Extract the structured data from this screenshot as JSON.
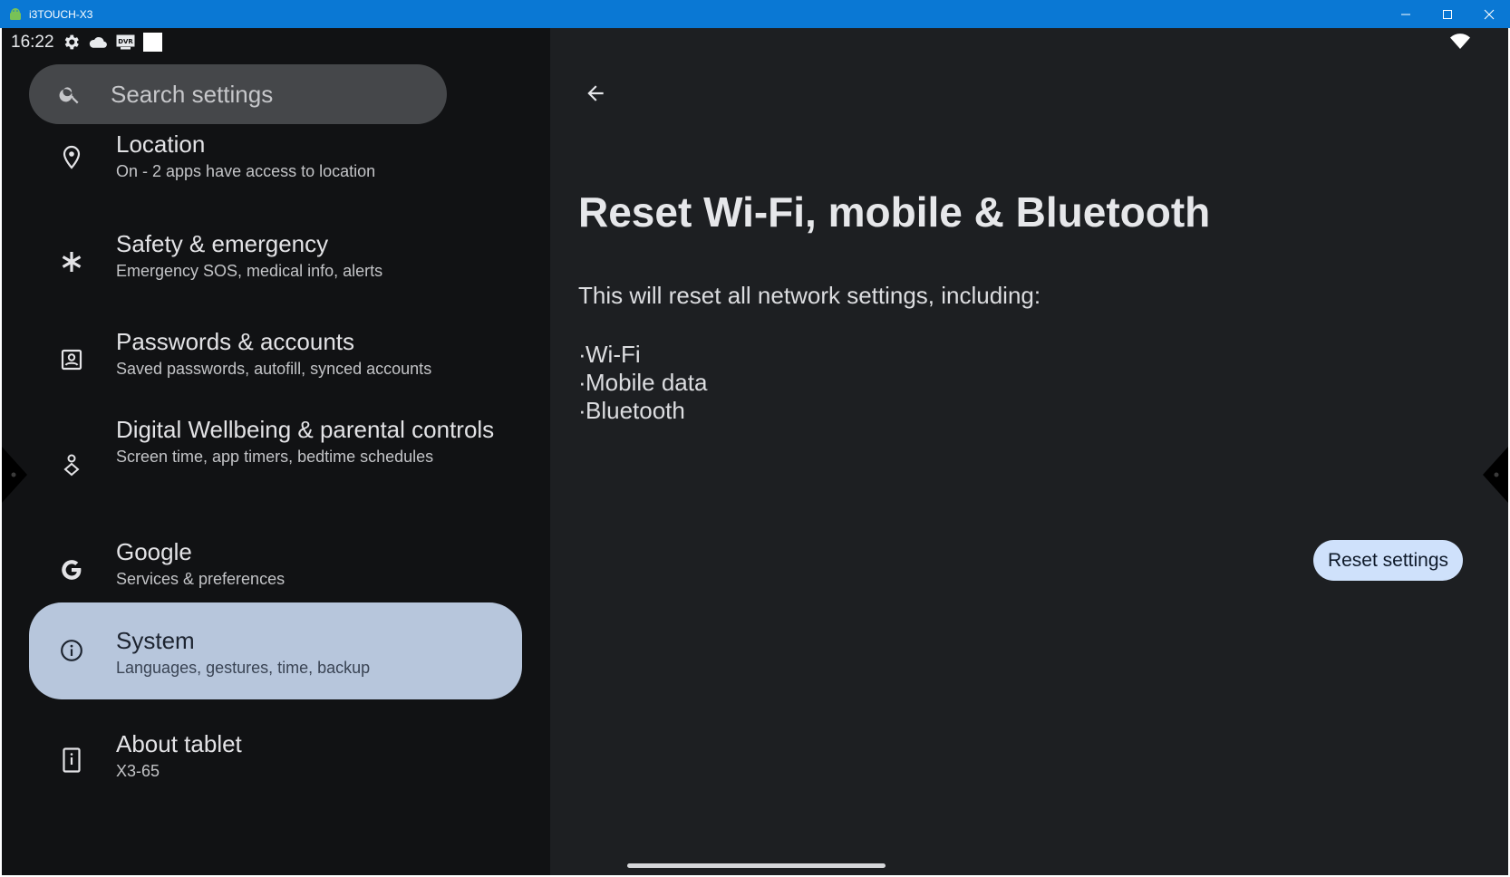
{
  "window": {
    "title": "i3TOUCH-X3"
  },
  "status_bar": {
    "time": "16:22",
    "icons": [
      "gear-icon",
      "cloud-icon",
      "dvr-icon",
      "square-icon"
    ],
    "right_icons": [
      "wifi-icon"
    ]
  },
  "search": {
    "placeholder": "Search settings"
  },
  "sidebar": {
    "items": [
      {
        "label": "Location",
        "sub": "On - 2 apps have access to location",
        "icon": "location-pin-icon"
      },
      {
        "label": "Safety & emergency",
        "sub": "Emergency SOS, medical info, alerts",
        "icon": "asterisk-icon"
      },
      {
        "label": "Passwords & accounts",
        "sub": "Saved passwords, autofill, synced accounts",
        "icon": "account-box-icon"
      },
      {
        "label": "Digital Wellbeing & parental controls",
        "sub": "Screen time, app timers, bedtime schedules",
        "icon": "wellbeing-icon"
      },
      {
        "label": "Google",
        "sub": "Services & preferences",
        "icon": "google-g-icon"
      },
      {
        "label": "System",
        "sub": "Languages, gestures, time, backup",
        "icon": "info-icon",
        "selected": true
      },
      {
        "label": "About tablet",
        "sub": "X3-65",
        "icon": "tablet-icon"
      }
    ]
  },
  "content": {
    "title": "Reset Wi-Fi, mobile & Bluetooth",
    "description": "This will reset all network settings, including:",
    "bullets": [
      "Wi-Fi",
      "Mobile data",
      "Bluetooth"
    ],
    "reset_button_label": "Reset settings",
    "bullet_char": "·"
  },
  "colors": {
    "titlebar": "#0a78d4",
    "selected_item": "#b7c6dc",
    "reset_button": "#cfe1fb",
    "left_pane": "#111214",
    "right_pane": "#1d1f22"
  }
}
